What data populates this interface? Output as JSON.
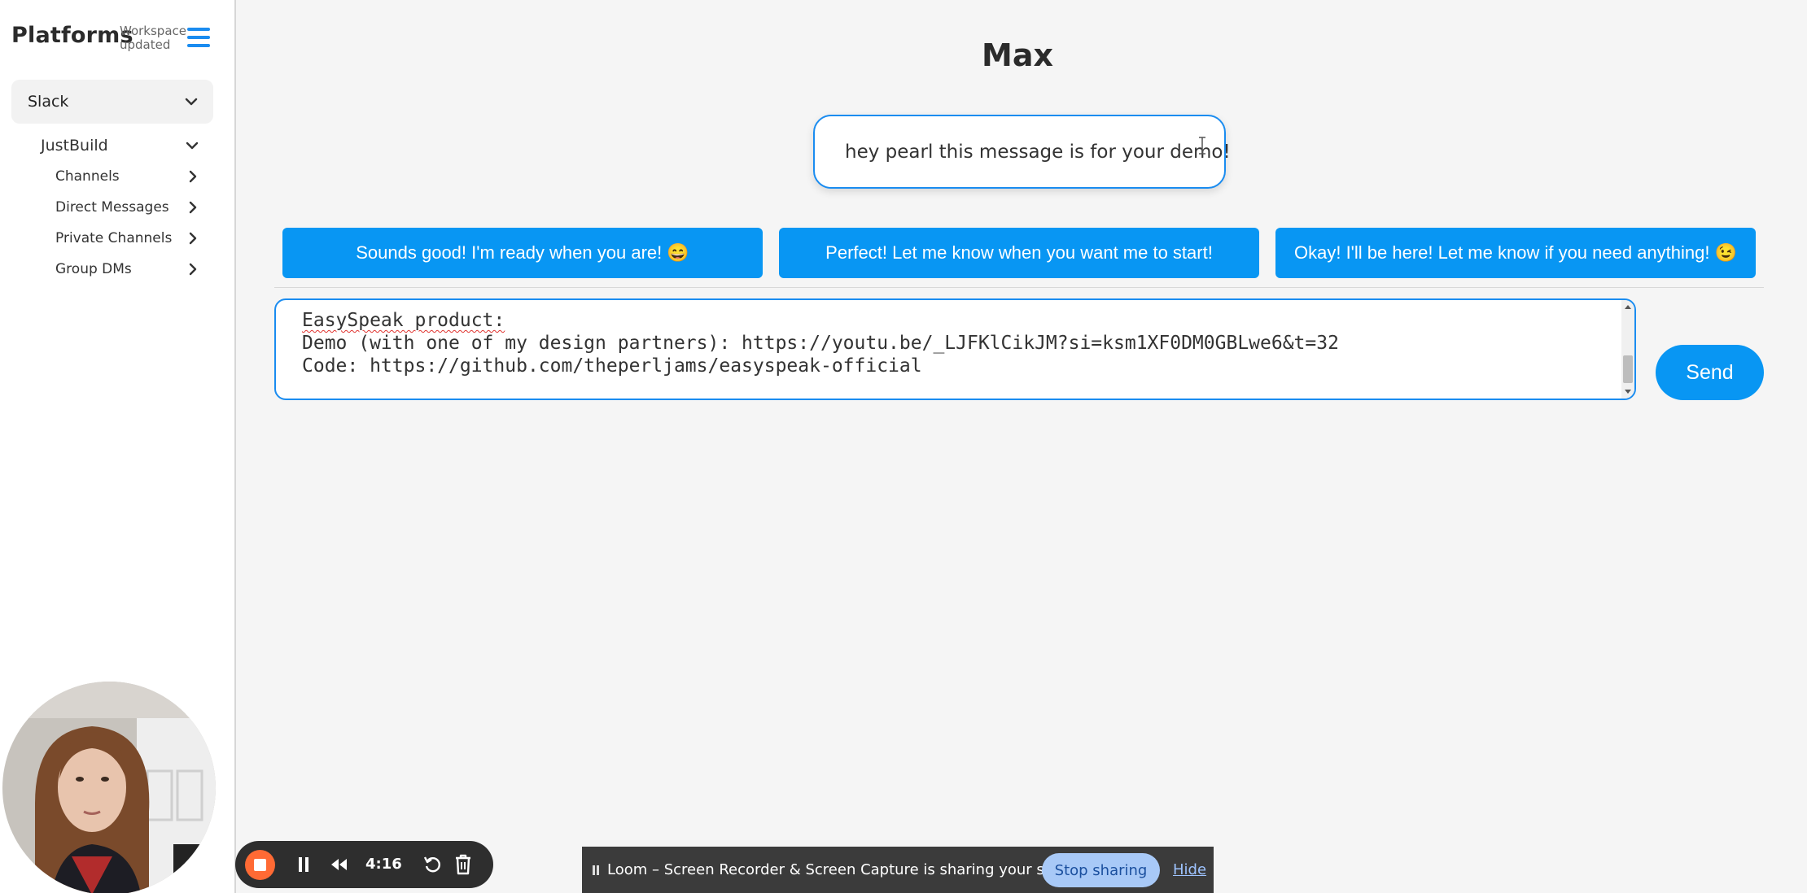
{
  "sidebar": {
    "brand": "Platforms",
    "workspace_status": "Workspace updated",
    "platform": "Slack",
    "workspace": "JustBuild",
    "sections": [
      "Channels",
      "Direct Messages",
      "Private Channels",
      "Group DMs"
    ]
  },
  "main": {
    "title": "Max",
    "incoming_message": "hey pearl this message is for your demo!",
    "suggestions": [
      "Sounds good! I'm ready when you are! 😄",
      "Perfect! Let me know when you want me to start!",
      "Okay! I'll be here! Let me know if you need anything! 😉"
    ],
    "compose_lines": [
      "EasySpeak product:",
      "Demo (with one of my design partners): https://youtu.be/_LJFKlCikJM?si=ksm1XF0DM0GBLwe6&t=32",
      "Code: https://github.com/theperljams/easyspeak-official"
    ],
    "send_label": "Send",
    "accent_color": "#0896f3"
  },
  "loom": {
    "timer": "4:16",
    "sharing_message": "Loom – Screen Recorder & Screen Capture is sharing your screen.",
    "stop_sharing_label": "Stop sharing",
    "hide_label": "Hide",
    "record_color": "#ff6a34"
  }
}
